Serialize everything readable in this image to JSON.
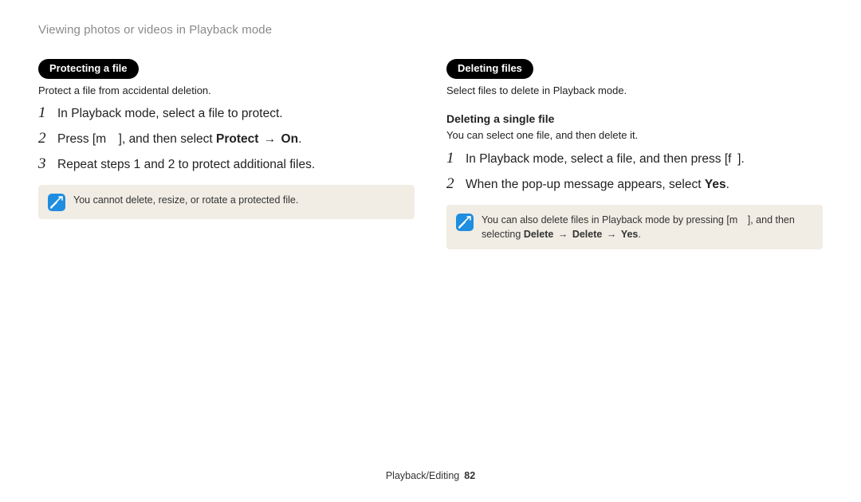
{
  "header": {
    "section_title": "Viewing photos or videos in Playback mode"
  },
  "left": {
    "pill": "Protecting a file",
    "intro": "Protect a file from accidental deletion.",
    "steps": [
      {
        "num": "1",
        "html": "In Playback mode, select a file to protect."
      },
      {
        "num": "2",
        "html": "Press [m ], and then select <b>Protect</b> <span class=\"arrow\">→</span> <b>On</b>."
      },
      {
        "num": "3",
        "html": "Repeat steps 1 and 2 to protect additional files."
      }
    ],
    "note": "You cannot delete, resize, or rotate a protected file."
  },
  "right": {
    "pill": "Deleting files",
    "intro": "Select files to delete in Playback mode.",
    "subhead": "Deleting a single file",
    "subintro": "You can select one file, and then delete it.",
    "steps": [
      {
        "num": "1",
        "html": "In Playback mode, select a file, and then press [f ]."
      },
      {
        "num": "2",
        "html": "When the pop-up message appears, select <b>Yes</b>."
      }
    ],
    "note_html": "You can also delete files in Playback mode by pressing [m ], and then selecting <b>Delete</b> <span class=\"arrow\">→</span> <b>Delete</b> <span class=\"arrow\">→</span> <b>Yes</b>."
  },
  "footer": {
    "chapter": "Playback/Editing",
    "page": "82"
  }
}
